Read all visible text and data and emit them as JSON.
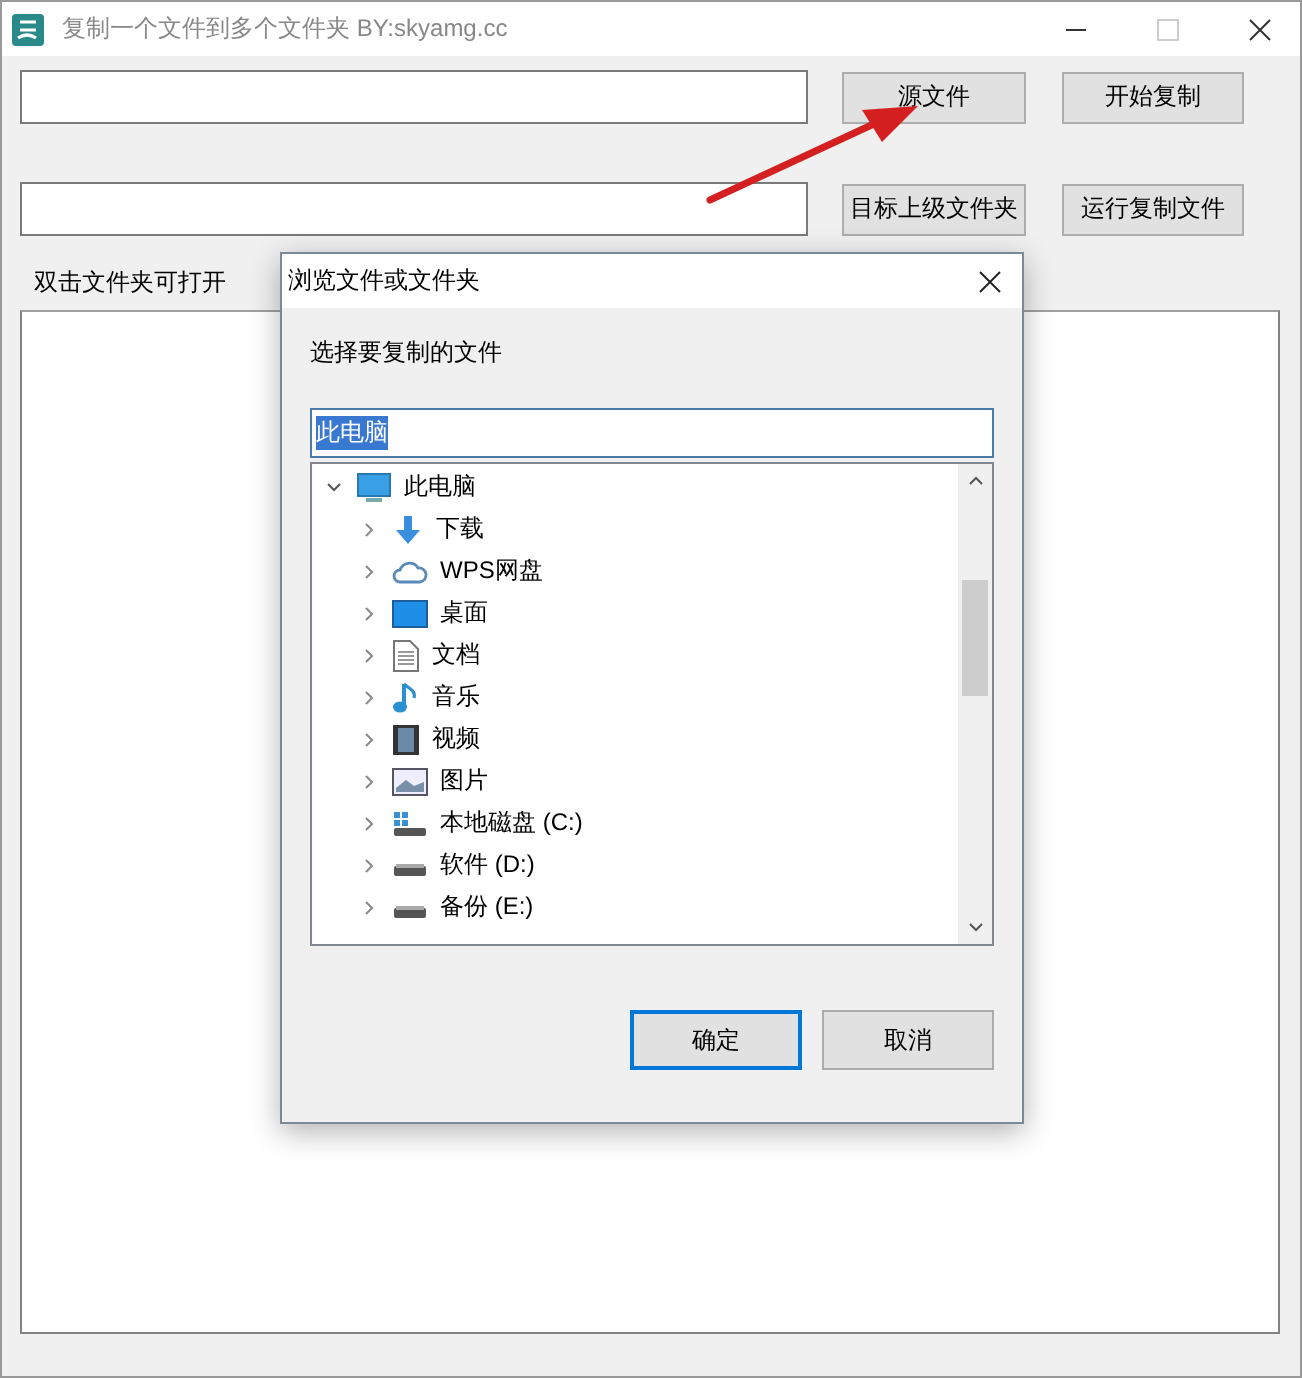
{
  "window": {
    "title": "复制一个文件到多个文件夹  BY:skyamg.cc",
    "maximize_disabled": true
  },
  "rows": [
    {
      "button": "源文件",
      "button2": "开始复制"
    },
    {
      "button": "目标上级文件夹",
      "button2": "运行复制文件"
    }
  ],
  "list_label": "双击文件夹可打开",
  "dialog": {
    "title": "浏览文件或文件夹",
    "prompt": "选择要复制的文件",
    "field": {
      "value": "此电脑",
      "text_selected": true
    },
    "tree": {
      "label": "此电脑",
      "expanded": true,
      "children": [
        {
          "label": "下载",
          "kind": "download",
          "expanded": false
        },
        {
          "label": "WPS网盘",
          "kind": "cloud",
          "expanded": false
        },
        {
          "label": "桌面",
          "kind": "desktop",
          "expanded": false
        },
        {
          "label": "文档",
          "kind": "document",
          "expanded": false
        },
        {
          "label": "音乐",
          "kind": "music",
          "expanded": false
        },
        {
          "label": "视频",
          "kind": "video",
          "expanded": false
        },
        {
          "label": "图片",
          "kind": "image",
          "expanded": false
        },
        {
          "label": "本地磁盘 (C:)",
          "kind": "system-drive",
          "expanded": false
        },
        {
          "label": "软件 (D:)",
          "kind": "drive",
          "expanded": false
        },
        {
          "label": "备份 (E:)",
          "kind": "drive",
          "expanded": false
        }
      ]
    },
    "buttons": [
      {
        "label": "确定",
        "default": true
      },
      {
        "label": "取消",
        "default": false
      }
    ]
  }
}
